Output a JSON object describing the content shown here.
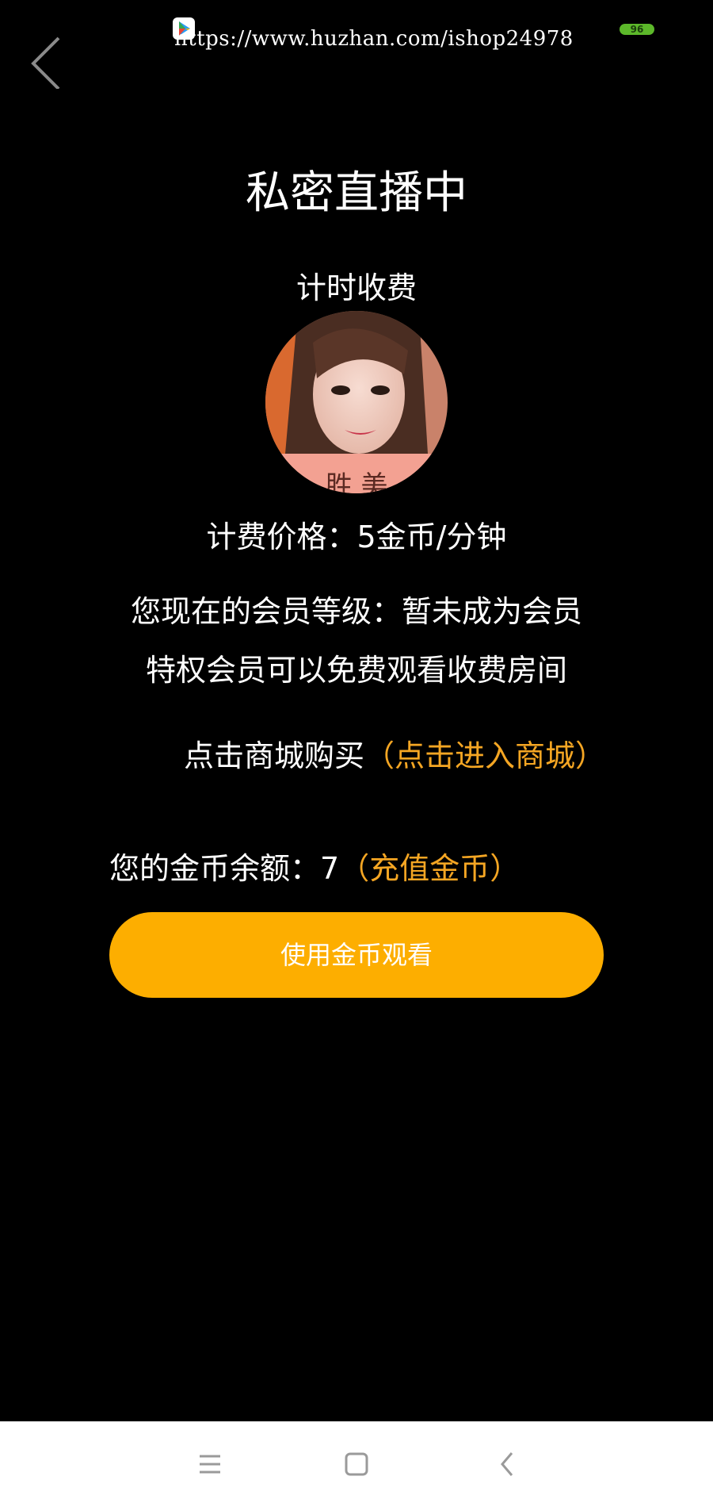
{
  "status_bar": {
    "app_icon": "play-store-icon",
    "watermark_url": "https://www.huzhan.com/ishop24978",
    "battery_level": "96",
    "battery_color": "#5cb82a"
  },
  "header": {
    "back_icon": "chevron-left-icon",
    "title": "私密直播中"
  },
  "room": {
    "billing_mode": "计时收费",
    "avatar": "host-avatar-photo",
    "price_line": "计费价格：5金币/分钟"
  },
  "membership": {
    "level_line": "您现在的会员等级：暂未成为会员",
    "privilege_line": "特权会员可以免费观看收费房间"
  },
  "shop": {
    "prompt": "点击商城购买",
    "link": "（点击进入商城）"
  },
  "balance": {
    "label": "您的金币余额：7",
    "recharge_link": "（充值金币）"
  },
  "actions": {
    "watch_button": "使用金币观看"
  },
  "nav_bar": {
    "menu_icon": "menu-icon",
    "home_icon": "home-square-icon",
    "back_icon": "back-triangle-icon"
  },
  "colors": {
    "accent": "#f5a623",
    "button": "#fdae00",
    "background": "#000000"
  }
}
